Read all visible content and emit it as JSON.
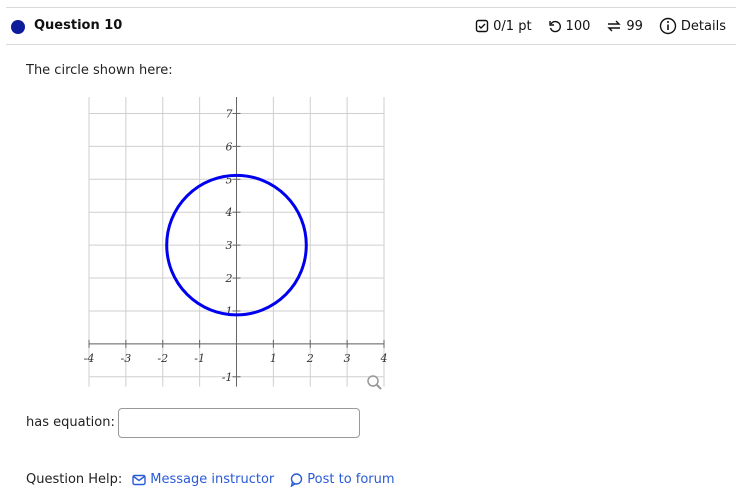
{
  "question": {
    "title": "Question 10",
    "score": "0/1 pt",
    "retries": "100",
    "attempts": "99",
    "details": "Details"
  },
  "prompt": "The circle shown here:",
  "graph": {
    "x_ticks": [
      "-4",
      "-3",
      "-2",
      "-1",
      "1",
      "2",
      "3",
      "4"
    ],
    "y_ticks": [
      "7",
      "6",
      "5",
      "4",
      "3",
      "2",
      "1",
      "-1"
    ],
    "circle": {
      "center_x": 0,
      "center_y": 3,
      "radius": 2
    },
    "circle_color": "#0000ee"
  },
  "answer": {
    "label": "has equation:",
    "value": ""
  },
  "help": {
    "label": "Question Help:",
    "message": "Message instructor",
    "forum": "Post to forum"
  },
  "colors": {
    "accent": "#0c1c9a",
    "link": "#2a5bd7"
  }
}
